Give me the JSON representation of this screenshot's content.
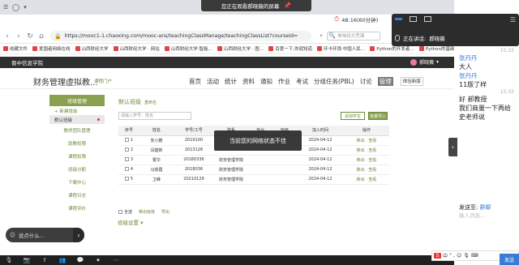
{
  "share_banner": {
    "text": "您正在观看郝晓薇的屏幕",
    "pin": "📌"
  },
  "browser": {
    "timer": "48:16(60分钟)",
    "timer_tab": "课",
    "url": "https://mooc1-1.chaoxing.com/mooc-ans/teachingClassManage/teachingClassList?courseId=",
    "url_host": "mooc1-1.chaoxing.com",
    "search_placeholder": "美味码大荒漠",
    "bookmarks": [
      "收藏文件",
      "爱国者网络在线",
      "山西财经大学",
      "山西财经大学 · 网站",
      "山西财经大学·智能…",
      "山西财经大学 · 图…",
      "百度一下,你就知道",
      "环卡环境·中国人民…",
      "Python的开发者…",
      "Python的基础与…"
    ]
  },
  "site": {
    "school": "晋中信息学院",
    "user": "郝晓薇",
    "course_title": "财务管理虚拟教...",
    "course_sub": "课程门户",
    "nav": [
      "首页",
      "活动",
      "统计",
      "资料",
      "通知",
      "作业",
      "考试",
      "分组任务(PBL)",
      "讨论",
      "管理"
    ],
    "nav_active": "管理",
    "mode_button": "体验新版"
  },
  "sidebar": {
    "head": "班级管理",
    "add_class": "+ 新建班级",
    "default_class": "默认班级",
    "items": [
      "教师团队管理",
      "助教权限",
      "课程权限",
      "班级分配",
      "下载中心",
      "课程日志",
      "课程评价"
    ]
  },
  "main": {
    "breadcrumb": "默认班级",
    "edit_label": "重命名",
    "search_placeholder": "请输入学号、姓名",
    "add_student": "添加学生",
    "import_student": "批量导入",
    "columns": [
      "序号",
      "姓名",
      "学号/工号",
      "院系",
      "专业",
      "班级",
      "加入时间",
      "操作"
    ],
    "rows": [
      {
        "no": "1",
        "name": "安小鹏",
        "id": "2019100",
        "dept": "",
        "join": "2024-04-12",
        "ops": "移出 · 查看"
      },
      {
        "no": "2",
        "name": "闫建新",
        "id": "2013126",
        "dept": "",
        "join": "2024-04-12",
        "ops": "移出 · 查看"
      },
      {
        "no": "3",
        "name": "曹华",
        "id": "20180336",
        "dept": "财务管理学院",
        "join": "2024-04-12",
        "ops": "移出 · 查看"
      },
      {
        "no": "4",
        "name": "马俊霞",
        "id": "2018036",
        "dept": "财务管理学院",
        "join": "2024-04-12",
        "ops": "移出 · 查看"
      },
      {
        "no": "5",
        "name": "卫峰",
        "id": "20210129",
        "dept": "财务管理学院",
        "join": "2024-04-12",
        "ops": "移出 · 查看"
      }
    ],
    "footer_ops": [
      "全选",
      "移出班级",
      "导出"
    ],
    "class_settings": "班级设置 ▾"
  },
  "toast": "当前您的网络状态不佳",
  "chat_pill": {
    "placeholder": "说点什么...",
    "emoji": "☺"
  },
  "panel": {
    "speaking_label": "正在讲话:",
    "speaking_name": "郝晓薇",
    "messages": [
      {
        "type": "time",
        "text": "15:33"
      },
      {
        "type": "name",
        "text": "张丹丹"
      },
      {
        "type": "text",
        "text": "大人"
      },
      {
        "type": "name",
        "text": "张丹丹"
      },
      {
        "type": "text",
        "text": "11版了样"
      },
      {
        "type": "time",
        "text": "15:33"
      },
      {
        "type": "text",
        "text": "好 郝教授"
      },
      {
        "type": "text",
        "text": "我们商量一下再给"
      },
      {
        "type": "text",
        "text": "史老师说"
      }
    ],
    "send_to_label": "发送至:",
    "send_to_target": "群聊",
    "input_placeholder": "输入消息...",
    "send_button": "发送"
  },
  "ime": {
    "logo": "S",
    "items": [
      "中",
      "°",
      ",",
      "☺",
      "🎙",
      "⌨"
    ]
  },
  "colors": {
    "accent_green": "#8aa04e",
    "link_blue": "#3a7bd5"
  }
}
